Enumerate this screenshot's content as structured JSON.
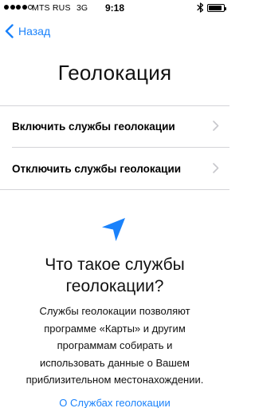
{
  "status_bar": {
    "carrier": "MTS RUS",
    "network": "3G",
    "time": "9:18",
    "signal_strength_dots": 4,
    "signal_total_dots": 5,
    "battery_level": 0.9
  },
  "nav": {
    "back_label": "Назад",
    "back_icon": "chevron-left-icon"
  },
  "page": {
    "title": "Геолокация"
  },
  "options": [
    {
      "label": "Включить службы геолокации",
      "icon": "chevron-right-icon"
    },
    {
      "label": "Отключить службы геолокации",
      "icon": "chevron-right-icon"
    }
  ],
  "info": {
    "icon": "location-arrow-icon",
    "heading_line1": "Что такое службы",
    "heading_line2": "геолокации?",
    "body_lines": [
      "Службы геолокации позволяют",
      "программе «Карты» и другим",
      "программам собирать и",
      "использовать данные о Вашем",
      "приблизительном местонахождении."
    ],
    "link_label": "О Службах геолокации"
  },
  "colors": {
    "accent": "#1a82fb",
    "separator": "#d4d4d8",
    "chevron": "#c7c7cc"
  }
}
